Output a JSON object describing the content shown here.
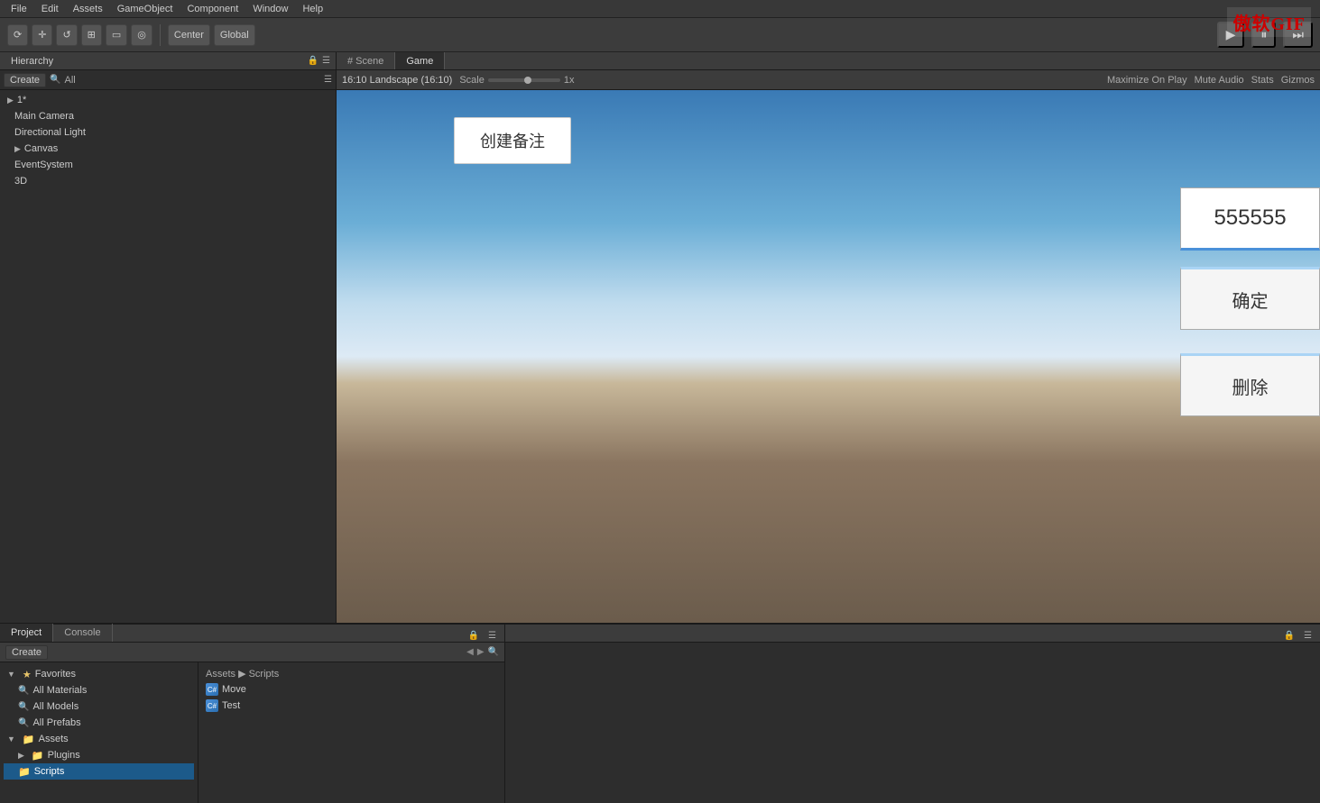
{
  "watermark": "傲软GIF",
  "menubar": {
    "items": [
      "File",
      "Edit",
      "Assets",
      "GameObject",
      "Component",
      "Window",
      "Help"
    ]
  },
  "toolbar": {
    "transform_tools": [
      "⟳",
      "+",
      "↺",
      "⊞",
      "▭",
      "◎"
    ],
    "center_label": "Center",
    "global_label": "Global",
    "play_label": "▶",
    "pause_label": "⏸",
    "step_label": "⏭"
  },
  "hierarchy": {
    "panel_title": "Hierarchy",
    "create_label": "Create",
    "all_label": "All",
    "items": [
      {
        "label": "▶ 1*",
        "indent": 0
      },
      {
        "label": "Main Camera",
        "indent": 1
      },
      {
        "label": "Directional Light",
        "indent": 1
      },
      {
        "label": "▶ Canvas",
        "indent": 1
      },
      {
        "label": "EventSystem",
        "indent": 1
      },
      {
        "label": "3D",
        "indent": 1
      }
    ]
  },
  "scene_tabs": {
    "scene_label": "# Scene",
    "game_label": "Game"
  },
  "game_toolbar": {
    "aspect_label": "16:10 Landscape (16:10)",
    "scale_label": "Scale",
    "scale_value": "1x",
    "maximize_label": "Maximize On Play",
    "mute_label": "Mute Audio",
    "stats_label": "Stats",
    "gizmos_label": "Gizmos"
  },
  "game_ui": {
    "create_note": "创建备注",
    "number_display": "555555",
    "confirm_btn": "确定",
    "delete_btn": "删除"
  },
  "bottom": {
    "project_tab": "Project",
    "console_tab": "Console",
    "create_label": "Create",
    "favorites": {
      "label": "Favorites",
      "items": [
        {
          "label": "All Materials",
          "indent": 1
        },
        {
          "label": "All Models",
          "indent": 1
        },
        {
          "label": "All Prefabs",
          "indent": 1
        }
      ]
    },
    "assets": {
      "label": "Assets",
      "items": [
        {
          "label": "Plugins",
          "indent": 1
        },
        {
          "label": "Scripts",
          "indent": 1,
          "selected": true
        }
      ]
    },
    "breadcrumb": "Assets ▶ Scripts",
    "scripts": [
      {
        "label": "Move"
      },
      {
        "label": "Test"
      }
    ]
  }
}
